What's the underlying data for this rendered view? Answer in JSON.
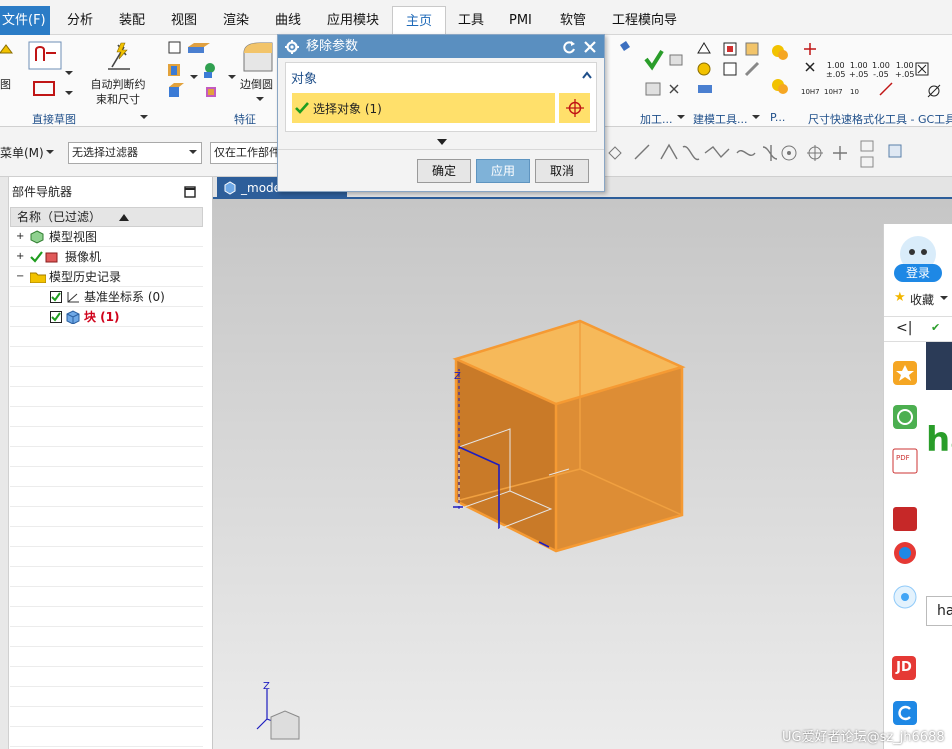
{
  "menu": {
    "file": "文件(F)",
    "tabs": [
      "分析",
      "装配",
      "视图",
      "渲染",
      "曲线",
      "应用模块",
      "主页",
      "工具",
      "PMI",
      "软管",
      "工程模向导"
    ]
  },
  "ribbon": {
    "sketch_left_label": "图",
    "auto_constraint_label": "自动判断约\n束和尺寸",
    "edge_round_label": "边倒圆",
    "group_direct_sketch": "直接草图",
    "group_feature": "特征",
    "group_machining": "加工...",
    "group_modeling_tools": "建模工具...",
    "group_p": "P...",
    "group_dimension": "尺寸快速格式化工具 - GC工具",
    "dim_texts": [
      "1.00",
      "1.00",
      "1.00",
      "1.00",
      "±.05",
      "+.05",
      "-.05",
      "+.05",
      "10H7",
      "10H7",
      "10"
    ],
    "tolerance_texts": [
      "10H7"
    ]
  },
  "toolbar2": {
    "menu_label": "菜单(M)",
    "filter_select": "无选择过滤器",
    "scope_select": "仅在工作部件"
  },
  "navigator": {
    "title": "部件导航器",
    "column_header": "名称（已过滤）",
    "rows": [
      {
        "label": "模型视图",
        "color": "#222222"
      },
      {
        "label": "摄像机",
        "color": "#222222"
      },
      {
        "label": "模型历史记录",
        "color": "#222222"
      },
      {
        "label": "基准坐标系 (0)",
        "color": "#222222"
      },
      {
        "label": "块 (1)",
        "color": "#d0021b"
      }
    ]
  },
  "graphics": {
    "tab_label": "_mode"
  },
  "dialog": {
    "title": "移除参数",
    "section_title": "对象",
    "select_label": "选择对象 (1)",
    "ok": "确定",
    "apply": "应用",
    "cancel": "取消"
  },
  "sidepanel": {
    "login": "登录",
    "favorites": "收藏",
    "browser_text": "ha",
    "search_text": "ha",
    "jd": "JD"
  },
  "watermark": "UG爱好者论坛@sz_jh6688",
  "colors": {
    "accent": "#2b7cc6",
    "dialog_title": "#5a8fc0",
    "cube_face": "#e08a2a",
    "cube_top": "#f6b95a",
    "selection_row": "#ffe06b",
    "highlight_red": "#d0021b"
  }
}
